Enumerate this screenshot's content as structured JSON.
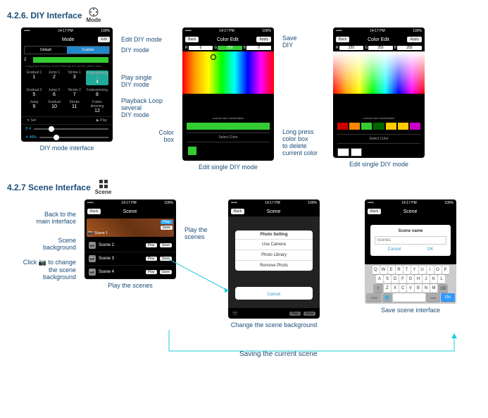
{
  "sections": {
    "diy": {
      "num": "4.2.6.",
      "title": "DIY Interface",
      "icon_label": "Mode"
    },
    "scene": {
      "num": "4.2.7",
      "title": "Scene Interface",
      "icon_label": "Scene"
    }
  },
  "status": {
    "time": "14:17 PM",
    "battery": "100%",
    "signal": "•••••"
  },
  "mode_phone": {
    "title": "Mode",
    "edit": "Edit",
    "tab_default": "Default",
    "tab_custom": "Custom",
    "index": "2",
    "hint": "Long press colorbox could exchange the current pattern layer",
    "cells": [
      {
        "t": "Gradual 1",
        "n": "1"
      },
      {
        "t": "Jump 1",
        "n": "2"
      },
      {
        "t": "Stroke 1",
        "n": "3"
      },
      {
        "t": "Fadesimming 1",
        "n": "4"
      },
      {
        "t": "Gradual 2",
        "n": "5"
      },
      {
        "t": "Jump 2",
        "n": "6"
      },
      {
        "t": "Stroke 2",
        "n": "7"
      },
      {
        "t": "Fadesimming",
        "n": "8"
      },
      {
        "t": "Jump",
        "n": "9"
      },
      {
        "t": "Gradual",
        "n": "10"
      },
      {
        "t": "Stroke",
        "n": "11"
      },
      {
        "t": "Fades dimming",
        "n": "12"
      }
    ],
    "set": "Set",
    "play": "Play",
    "slider1": "4",
    "slider2": "40%"
  },
  "color_edit": {
    "title": "Color Edit",
    "back": "Back",
    "apply": "Apply",
    "r": "R",
    "g": "G",
    "b": "B",
    "rgb_green": {
      "r": "0",
      "g": "255",
      "b": "0"
    },
    "rgb_white": {
      "r": "255",
      "g": "255",
      "b": "255"
    },
    "ccc": "current color combination",
    "select": "Select Color"
  },
  "scene": {
    "title": "Scene",
    "back": "Back",
    "play": "Play",
    "save": "Save",
    "items": [
      "Scene 1",
      "Scene 2",
      "Scene 3",
      "Scene 4"
    ],
    "modal": {
      "title": "Photo Setting",
      "use_camera": "Use Camera",
      "photo_library": "Photo Library",
      "remove_photo": "Remove Photo",
      "cancel": "Cancel"
    },
    "name_modal": {
      "title": "Scene name",
      "placeholder": "Scene1",
      "cancel": "Cancel",
      "ok": "OK"
    },
    "keyboard_rows": [
      [
        "Q",
        "W",
        "E",
        "R",
        "T",
        "Y",
        "U",
        "I",
        "O",
        "P"
      ],
      [
        "A",
        "S",
        "D",
        "F",
        "G",
        "H",
        "J",
        "K",
        "L"
      ],
      [
        "Z",
        "X",
        "C",
        "V",
        "B",
        "N",
        "M"
      ]
    ],
    "keyboard_bottom": {
      "num": ".?123",
      "lang": "🌐",
      "space": "   ",
      "com": ".com",
      "go": "Go"
    }
  },
  "annotations": {
    "edit_diy": "Edit DIY mode",
    "diy_mode": "DIY mode",
    "play_single": "Play single\nDIY mode",
    "playback_loop": "Playback Loop\nseveral\nDIY mode",
    "color_box": "Color\nbox",
    "save_diy": "Save\nDIY",
    "long_press": "Long press\ncolor box\nto delete\ncurrent color",
    "back_main": "Back to the\nmain interface",
    "scene_bg": "Scene\nbackground",
    "click_change": "Click 📷 to change\nthe scene\nbackground",
    "play_scenes": "Play the\nscenes",
    "saving_current": "Saving the current scene"
  },
  "captions": {
    "diy_mode": "DIY mode interface",
    "edit_single1": "Edit single DIY mode",
    "edit_single2": "Edit single DIY mode",
    "play_scenes": "Play the scenes",
    "change_bg": "Change the scene background",
    "save_scene": "Save scene interface"
  }
}
